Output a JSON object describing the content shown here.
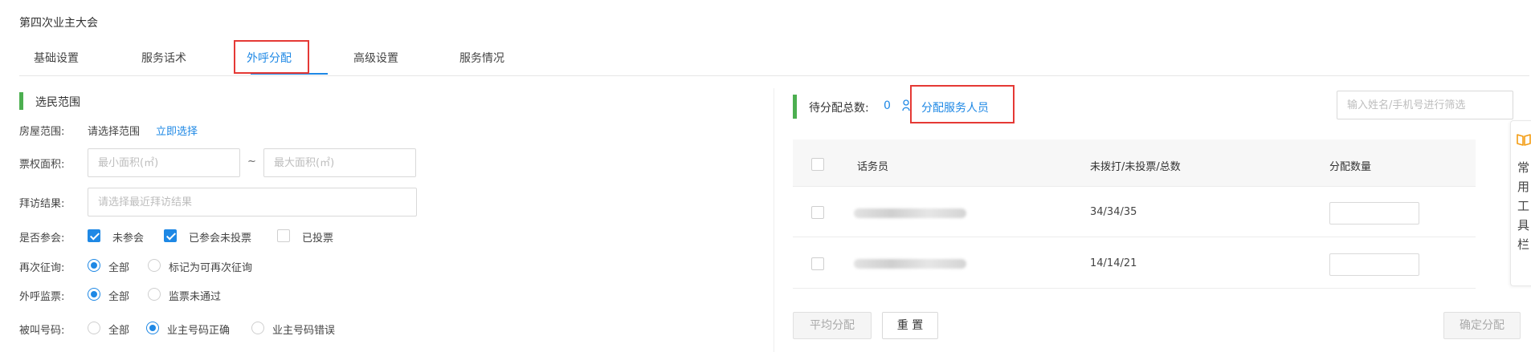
{
  "page": {
    "title": "第四次业主大会"
  },
  "tabs": [
    "基础设置",
    "服务话术",
    "外呼分配",
    "高级设置",
    "服务情况"
  ],
  "left": {
    "section_title": "选民范围",
    "house_range": {
      "label": "房屋范围:",
      "value": "请选择范围",
      "link": "立即选择"
    },
    "vote_area": {
      "label": "票权面积:",
      "min_placeholder": "最小面积(㎡)",
      "separator": "~",
      "max_placeholder": "最大面积(㎡)"
    },
    "visit_result": {
      "label": "拜访结果:",
      "placeholder": "请选择最近拜访结果"
    },
    "attend": {
      "label": "是否参会:",
      "options": [
        "未参会",
        "已参会未投票",
        "已投票"
      ],
      "checked": [
        true,
        true,
        false
      ]
    },
    "reinquire": {
      "label": "再次征询:",
      "options": [
        "全部",
        "标记为可再次征询"
      ],
      "selected": 0
    },
    "supervise": {
      "label": "外呼监票:",
      "options": [
        "全部",
        "监票未通过"
      ],
      "selected": 0
    },
    "callee": {
      "label": "被叫号码:",
      "options": [
        "全部",
        "业主号码正确",
        "业主号码错误"
      ],
      "selected": 1
    }
  },
  "right": {
    "pending_label": "待分配总数:",
    "pending_count": "0",
    "assign_icon": "person-icon",
    "assign_link": "分配服务人员",
    "filter_placeholder": "输入姓名/手机号进行筛选",
    "table": {
      "headers": [
        "话务员",
        "未拨打/未投票/总数",
        "分配数量"
      ],
      "rows": [
        {
          "operator": "",
          "counts": "34/34/35",
          "qty": ""
        },
        {
          "operator": "",
          "counts": "14/14/21",
          "qty": ""
        }
      ]
    },
    "buttons": {
      "average": "平均分配",
      "reset": "重 置",
      "confirm": "确定分配"
    }
  },
  "side_toolbar": {
    "icon": "book-icon",
    "label": "常用工具栏"
  },
  "colors": {
    "accent": "#1e88e5",
    "section_bar": "#4caf50",
    "highlight_box": "#e53935",
    "toolbar_icon": "#f39c12"
  }
}
